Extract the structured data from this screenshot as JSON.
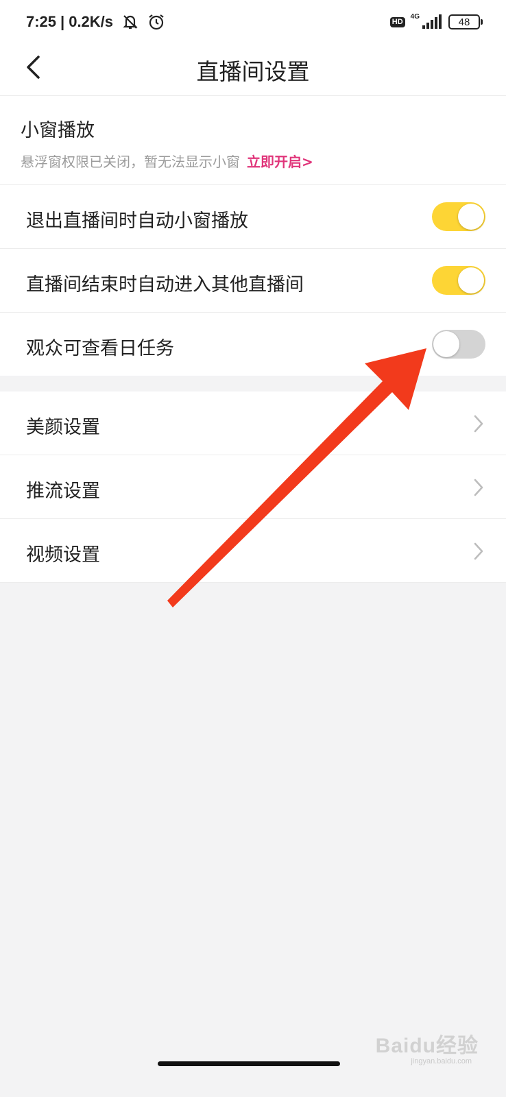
{
  "status_bar": {
    "time": "7:25",
    "separator": "|",
    "speed": "0.2K/s",
    "hd": "HD",
    "network": "4G",
    "battery": "48"
  },
  "header": {
    "title": "直播间设置"
  },
  "mini_window": {
    "title": "小窗播放",
    "description": "悬浮窗权限已关闭，暂无法显示小窗",
    "link": "立即开启>"
  },
  "toggles": [
    {
      "label": "退出直播间时自动小窗播放",
      "on": true
    },
    {
      "label": "直播间结束时自动进入其他直播间",
      "on": true
    },
    {
      "label": "观众可查看日任务",
      "on": false
    }
  ],
  "nav_items": [
    {
      "label": "美颜设置"
    },
    {
      "label": "推流设置"
    },
    {
      "label": "视频设置"
    }
  ],
  "colors": {
    "toggle_on": "#fdd535",
    "toggle_off": "#d4d4d4",
    "link": "#e0357a",
    "arrow": "#f23a1c"
  },
  "watermark": {
    "brand": "Baidu经验",
    "sub": "jingyan.baidu.com"
  }
}
